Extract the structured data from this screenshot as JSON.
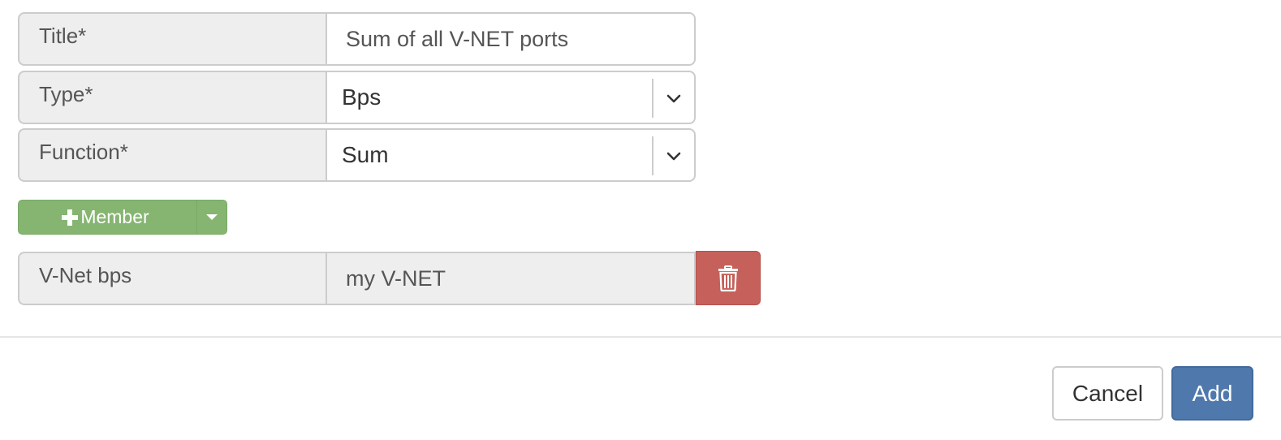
{
  "form": {
    "title": {
      "label": "Title*",
      "value": "Sum of all V-NET ports"
    },
    "type": {
      "label": "Type*",
      "selected": "Bps",
      "icon": "chevron-down-icon"
    },
    "function": {
      "label": "Function*",
      "selected": "Sum",
      "icon": "chevron-down-icon"
    },
    "add_member": {
      "label": "Member",
      "plus_icon": "plus-icon",
      "caret_icon": "caret-down-icon",
      "color": "#86b571"
    },
    "members": [
      {
        "label": "V-Net bps",
        "value": "my V-NET",
        "delete_icon": "trash-icon",
        "delete_color": "#c5605a"
      }
    ]
  },
  "footer": {
    "cancel_label": "Cancel",
    "add_label": "Add",
    "add_color": "#4f78ad"
  }
}
